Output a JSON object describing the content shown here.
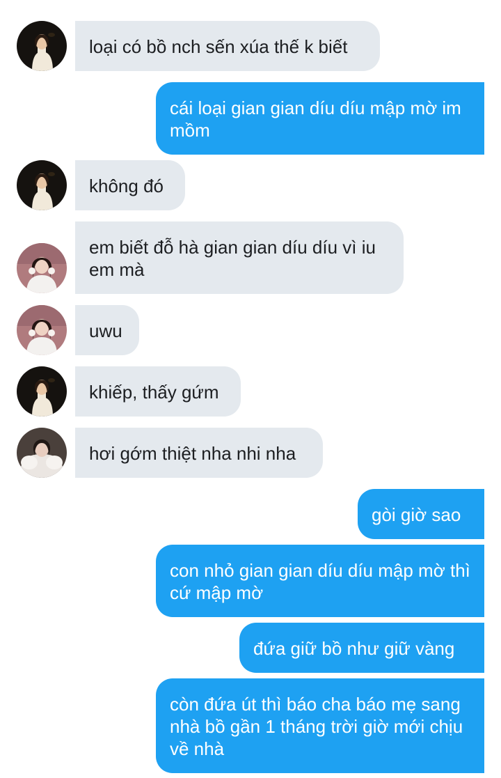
{
  "colors": {
    "incoming_bubble": "#e4e9ee",
    "outgoing_bubble": "#1ea1f2",
    "incoming_text": "#1c1e21",
    "outgoing_text": "#ffffff",
    "background": "#ffffff"
  },
  "messages": [
    {
      "sender": "contact-1",
      "direction": "incoming",
      "avatar": "avatar-girl-dark-background",
      "text": "loại có bồ nch sến xúa thế k biết"
    },
    {
      "sender": "me",
      "direction": "outgoing",
      "text": "cái loại gian gian díu díu mập mờ im mồm"
    },
    {
      "sender": "contact-1",
      "direction": "incoming",
      "avatar": "avatar-girl-dark-background",
      "text": "không đó"
    },
    {
      "sender": "contact-2",
      "direction": "incoming",
      "avatar": "avatar-girl-pink-background",
      "text": "em biết đỗ hà gian gian díu díu vì iu em mà"
    },
    {
      "sender": "contact-2",
      "direction": "incoming",
      "avatar": "avatar-girl-pink-background",
      "text": "uwu"
    },
    {
      "sender": "contact-1",
      "direction": "incoming",
      "avatar": "avatar-girl-dark-background",
      "text": "khiếp, thấy gứm"
    },
    {
      "sender": "contact-3",
      "direction": "incoming",
      "avatar": "avatar-girl-white-fur",
      "text": "hơi gớm thiệt nha nhi nha"
    },
    {
      "sender": "me",
      "direction": "outgoing",
      "text": "gòi giờ sao"
    },
    {
      "sender": "me",
      "direction": "outgoing",
      "text": "con nhỏ gian gian díu díu mập mờ thì cứ mập mờ"
    },
    {
      "sender": "me",
      "direction": "outgoing",
      "text": "đứa giữ bồ như giữ vàng"
    },
    {
      "sender": "me",
      "direction": "outgoing",
      "text": "còn đứa út thì báo cha báo mẹ sang nhà bồ gần 1 tháng trời giờ mới chịu về nhà"
    }
  ]
}
